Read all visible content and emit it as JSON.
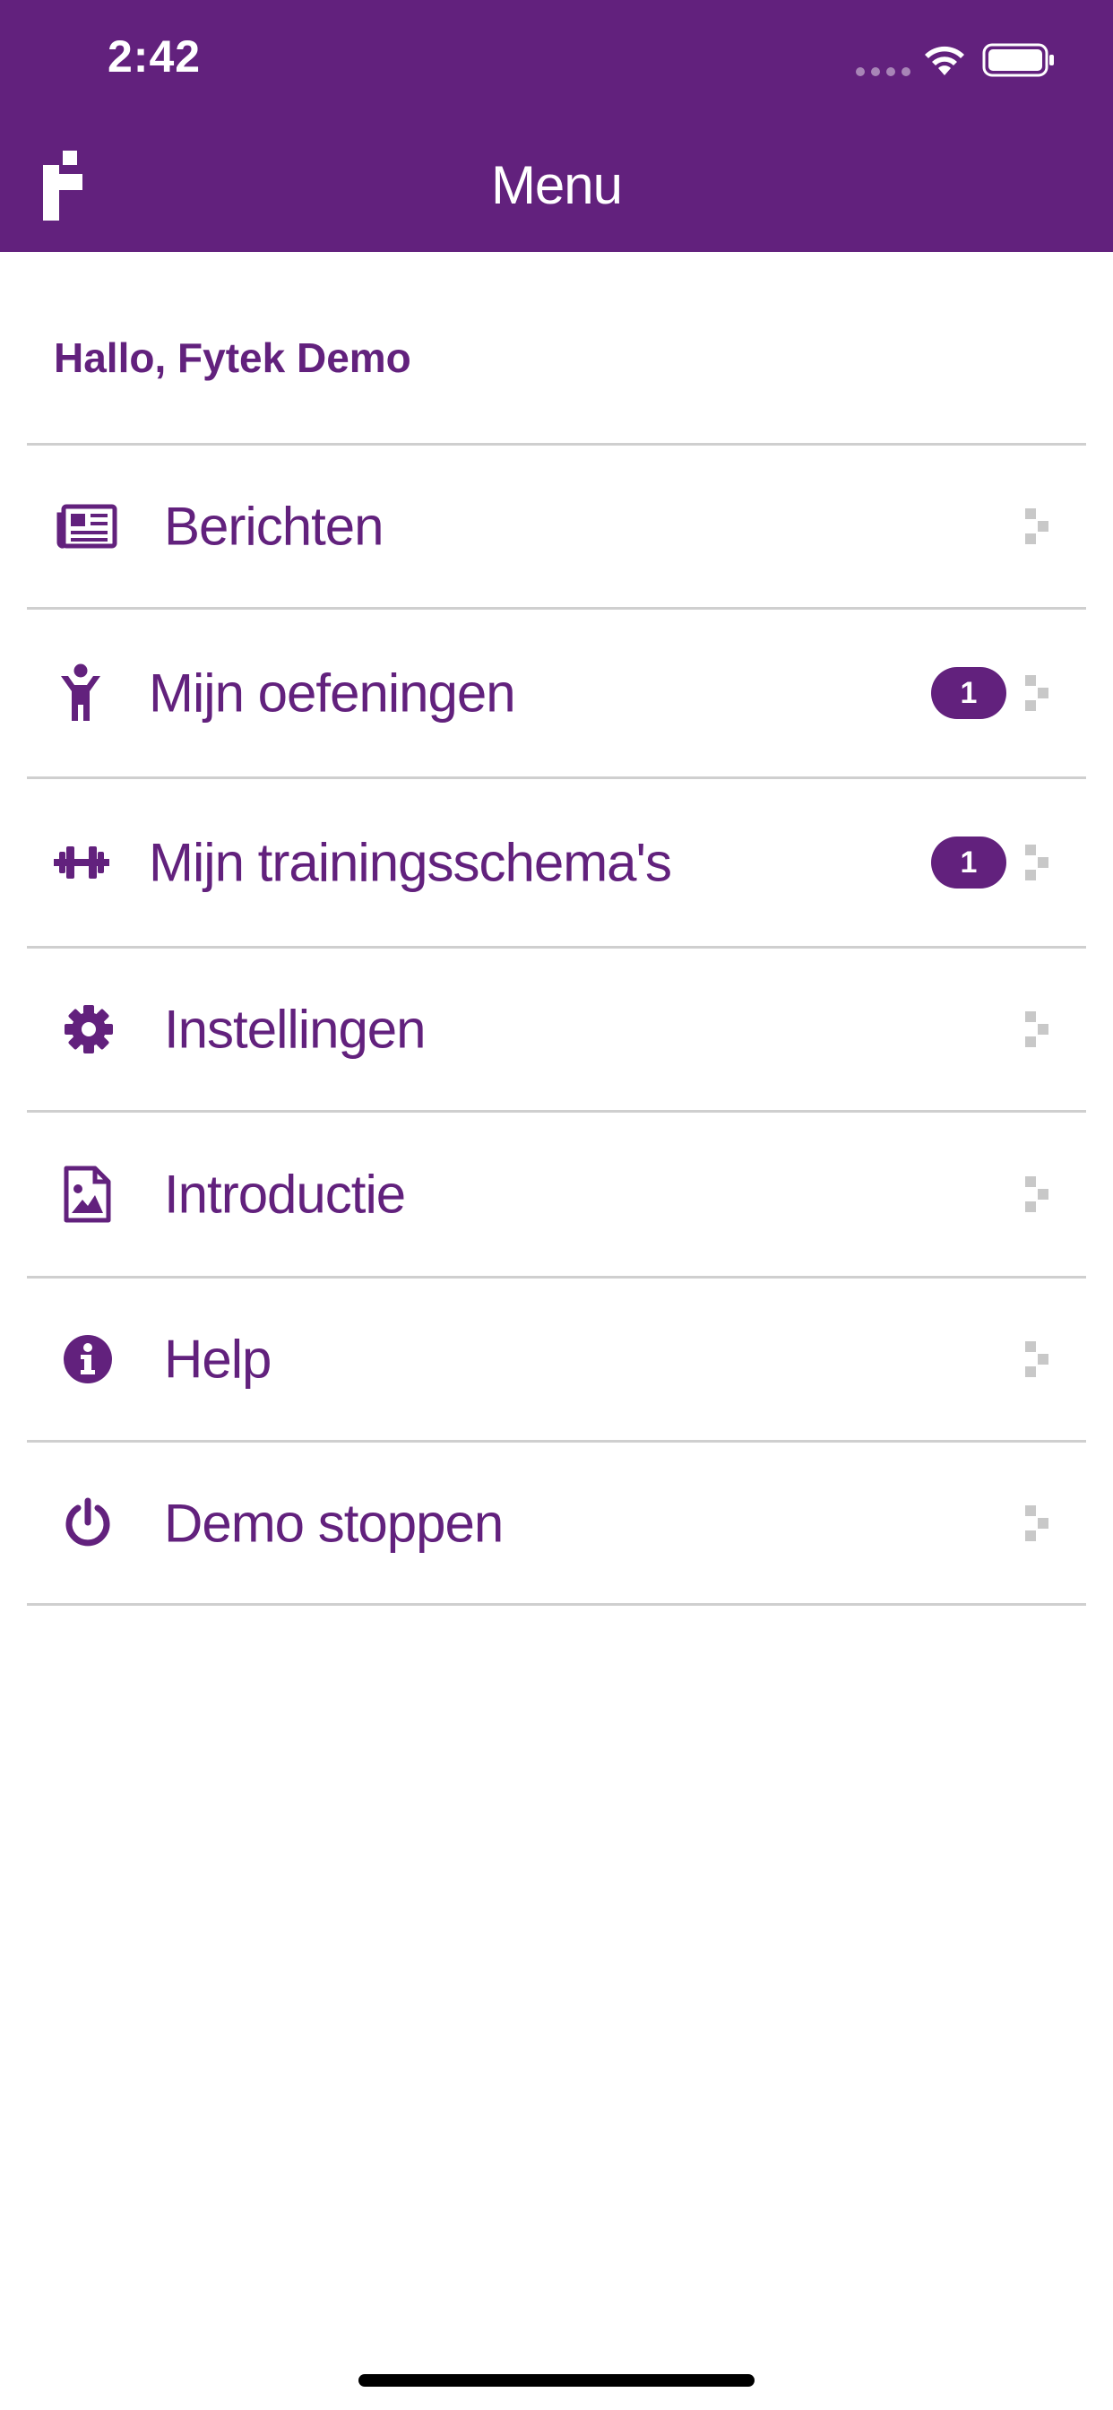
{
  "status_bar": {
    "time": "2:42"
  },
  "nav": {
    "title": "Menu"
  },
  "greeting": "Hallo, Fytek Demo",
  "menu": {
    "items": [
      {
        "label": "Berichten",
        "icon": "newspaper-icon",
        "badge": null
      },
      {
        "label": "Mijn oefeningen",
        "icon": "person-icon",
        "badge": "1"
      },
      {
        "label": "Mijn trainingsschema's",
        "icon": "dumbbell-icon",
        "badge": "1"
      },
      {
        "label": "Instellingen",
        "icon": "gear-icon",
        "badge": null
      },
      {
        "label": "Introductie",
        "icon": "image-file-icon",
        "badge": null
      },
      {
        "label": "Help",
        "icon": "info-icon",
        "badge": null
      },
      {
        "label": "Demo stoppen",
        "icon": "power-icon",
        "badge": null
      }
    ]
  },
  "colors": {
    "brand": "#62217d",
    "divider": "#cfcfcf",
    "chevron": "#c8c8c8"
  }
}
